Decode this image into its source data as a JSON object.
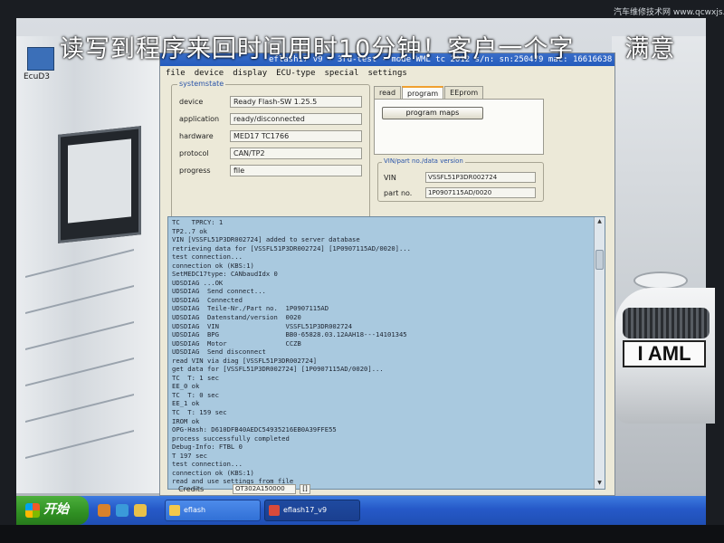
{
  "caption": "读写到程序来回时间用时10分钟！客户一个字　　满意",
  "watermark": "汽车维修技术网 www.qcwxjs.com",
  "desktop": {
    "icon_label": "EcuD3",
    "plate": "I AML"
  },
  "app": {
    "title": "eflash17 v9  - 3rd-test - mode WML tc 2012  s/n: sn:250479  mac: 16616638",
    "menu": [
      "file",
      "device",
      "display",
      "ECU-type",
      "special",
      "settings"
    ],
    "systemstate": {
      "title": "systemstate",
      "fields": [
        {
          "label": "device",
          "value": "Ready Flash-SW 1.25.5"
        },
        {
          "label": "application",
          "value": "ready/disconnected"
        },
        {
          "label": "hardware",
          "value": "MED17 TC1766"
        },
        {
          "label": "protocol",
          "value": "CAN/TP2"
        },
        {
          "label": "progress",
          "value": "file"
        }
      ],
      "progress_1": 0,
      "progress_2": 1
    },
    "tabs": [
      "read",
      "program",
      "EEprom"
    ],
    "active_tab": "program",
    "program_maps_button": "program maps",
    "vin_group": {
      "title": "VIN/part no./data version",
      "vin_label": "VIN",
      "vin_value": "VSSFL51P3DR002724",
      "part_label": "part no.",
      "part_value": "1P0907115AD/0020"
    },
    "log": [
      "TC   TPRCY: 1",
      "TP2..7 ok",
      "VIN [VSSFL51P3DR002724] added to server database",
      "retrieving data for [VSSFL51P3DR002724] [1P0907115AD/0020]...",
      "test connection...",
      "connection ok (KBS:1)",
      "SetMEDC17type: CANbaudIdx 0",
      "UDSDIAG ...OK",
      "UDSDIAG  Send connect...",
      "UDSDIAG  Connected",
      "UDSDIAG  Teile-Nr./Part no.  1P0907115AD",
      "UDSDIAG  Datenstand/version  0020",
      "UDSDIAG  VIN                 VSSFL51P3DR002724",
      "UDSDIAG  BPG                 BB0-65828.03.12AAH18---14101345",
      "UDSDIAG  Motor               CCZB",
      "UDSDIAG  Send disconnect",
      "read VIN via diag [VSSFL51P3DR002724]",
      "get data for [VSSFL51P3DR002724] [1P0907115AD/0020]...",
      "TC  T: 1 sec",
      "EE_0 ok",
      "TC  T: 0 sec",
      "EE_1 ok",
      "TC  T: 159 sec",
      "IROM ok",
      "OPG-Hash: D610DFB40AEDC54935216EB0A39FFE55",
      "process successfully completed",
      "Debug-Info: FTBL 0",
      "T 197 sec",
      "test connection...",
      "connection ok (KBS:1)",
      "read and use settings from file"
    ],
    "credits_label": "Credits",
    "credits_value": "OT302A150000",
    "credits_button": "[]"
  },
  "taskbar": {
    "start_label": "开始",
    "tasks": [
      {
        "label": "eflash"
      },
      {
        "label": "eflash17_v9"
      }
    ],
    "colors": {
      "start": "#2f8f22",
      "bar": "#2659c8"
    }
  }
}
